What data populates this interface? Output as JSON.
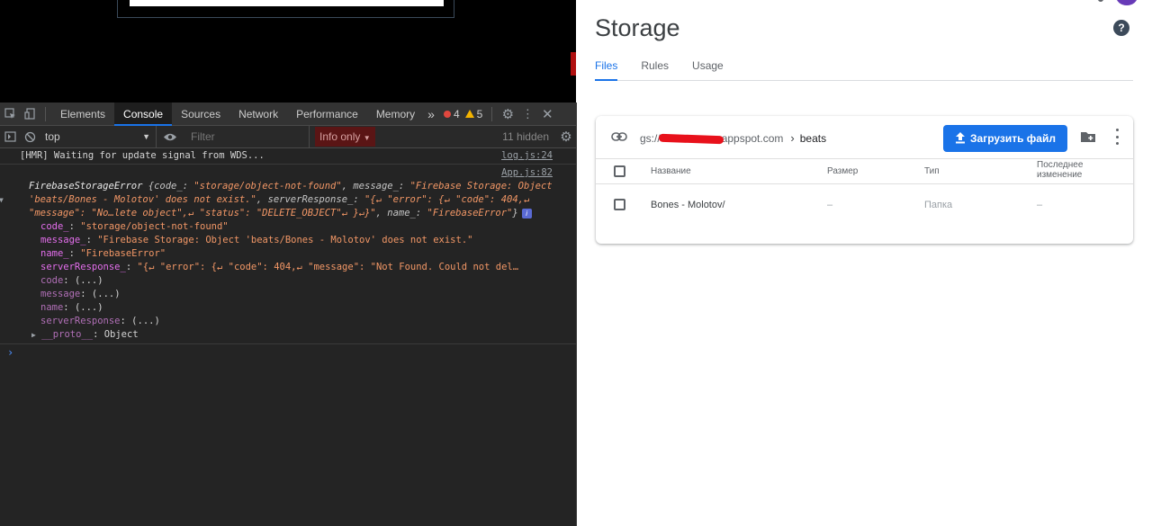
{
  "devtools": {
    "tabs": [
      "Elements",
      "Console",
      "Sources",
      "Network",
      "Performance",
      "Memory"
    ],
    "more_tabs": "»",
    "error_count": "4",
    "warning_count": "5",
    "context": "top",
    "filter_placeholder": "Filter",
    "level": "Info only",
    "hidden": "11 hidden",
    "console": {
      "hmr_message": "[HMR] Waiting for update signal from WDS...",
      "hmr_source": "log.js:24",
      "error_source": "App.js:82",
      "error_head": {
        "class_name": "FirebaseStorageError",
        "p1": " {code_: ",
        "code": "\"storage/object-not-found\"",
        "p2": ", message_: ",
        "message_start": "\"Firebase Storage: Object",
        "message_end": "'beats/Bones - Molotov' does not exist.\"",
        "p3": ", serverResponse_: ",
        "sr1": "\"{↵  \"error\": {↵    \"code\": 404,↵",
        "sr2": "\"message\": \"No…lete object\",↵    \"status\": \"DELETE_OBJECT\"↵  }↵}\"",
        "p4": ", name_: ",
        "name": "\"FirebaseError\"",
        "p5": "}"
      },
      "props": [
        {
          "key": "code_",
          "value": "\"storage/object-not-found\"",
          "dim": false,
          "plain": false
        },
        {
          "key": "message_",
          "value": "\"Firebase Storage: Object 'beats/Bones - Molotov' does not exist.\"",
          "dim": false,
          "plain": false
        },
        {
          "key": "name_",
          "value": "\"FirebaseError\"",
          "dim": false,
          "plain": false
        },
        {
          "key": "serverResponse_",
          "value": "\"{↵  \"error\": {↵    \"code\": 404,↵    \"message\": \"Not Found.  Could not del…",
          "dim": false,
          "plain": false
        },
        {
          "key": "code",
          "value": "(...)",
          "dim": true,
          "plain": true
        },
        {
          "key": "message",
          "value": "(...)",
          "dim": true,
          "plain": true
        },
        {
          "key": "name",
          "value": "(...)",
          "dim": true,
          "plain": true
        },
        {
          "key": "serverResponse",
          "value": "(...)",
          "dim": true,
          "plain": true
        }
      ],
      "proto_key": "__proto__",
      "proto_value": "Object",
      "prompt": "›"
    }
  },
  "storage": {
    "title": "Storage",
    "tabs": [
      {
        "label": "Files",
        "active": true
      },
      {
        "label": "Rules",
        "active": false
      },
      {
        "label": "Usage",
        "active": false
      }
    ],
    "bucket_prefix": "gs://",
    "bucket_suffix": "appspot.com",
    "current_folder": "beats",
    "upload_label": "Загрузить файл",
    "columns": {
      "name": "Название",
      "size": "Размер",
      "type": "Тип",
      "modified_line1": "Последнее",
      "modified_line2": "изменение"
    },
    "rows": [
      {
        "name": "Bones - Molotov/",
        "size": "–",
        "type": "Папка",
        "modified": "–"
      }
    ],
    "colors": {
      "accent": "#1a73e8",
      "redaction": "#e8111b"
    }
  }
}
